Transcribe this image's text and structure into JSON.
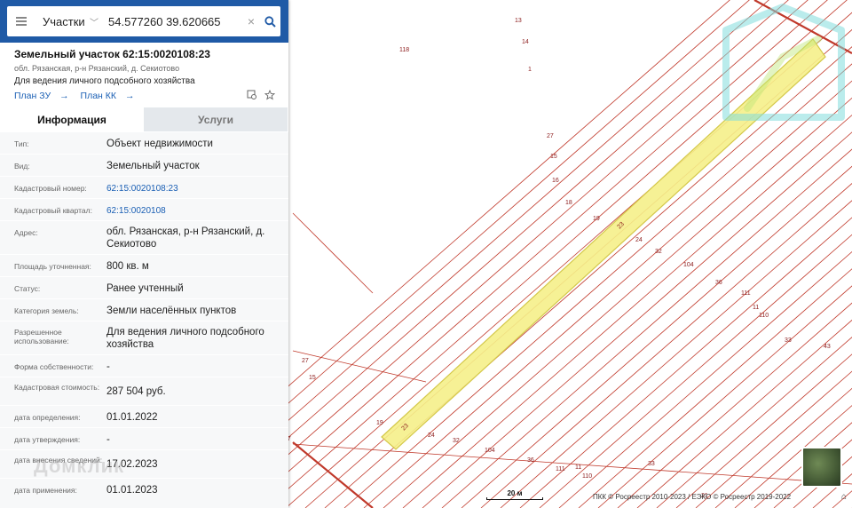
{
  "search": {
    "type": "Участки",
    "query": "54.577260 39.620665"
  },
  "parcel": {
    "title": "Земельный участок 62:15:0020108:23",
    "address_short": "обл. Рязанская, р-н Рязанский, д. Секиотово",
    "purpose": "Для ведения личного подсобного хозяйства",
    "links": [
      "План ЗУ",
      "План КК"
    ]
  },
  "tabs": [
    "Информация",
    "Услуги"
  ],
  "info": [
    {
      "label": "Тип:",
      "value": "Объект недвижимости"
    },
    {
      "label": "Вид:",
      "value": "Земельный участок"
    },
    {
      "label": "Кадастровый номер:",
      "value": "62:15:0020108:23"
    },
    {
      "label": "Кадастровый квартал:",
      "value": "62:15:0020108"
    },
    {
      "label": "Адрес:",
      "value": "обл. Рязанская, р-н Рязанский, д. Секиотово"
    },
    {
      "label": "Площадь уточненная:",
      "value": "800 кв. м"
    },
    {
      "label": "Статус:",
      "value": "Ранее учтенный"
    },
    {
      "label": "Категория земель:",
      "value": "Земли населённых пунктов"
    },
    {
      "label": "Разрешенное использование:",
      "value": "Для ведения личного подсобного хозяйства"
    },
    {
      "label": "Форма собственности:",
      "value": "-"
    },
    {
      "label": "Кадастровая стоимость:",
      "value": "287 504 руб."
    },
    {
      "label": "дата определения:",
      "value": "01.01.2022"
    },
    {
      "label": "дата утверждения:",
      "value": "-"
    },
    {
      "label": "дата внесения сведений:",
      "value": "17.02.2023"
    },
    {
      "label": "дата применения:",
      "value": "01.01.2023"
    }
  ],
  "watermark": "Домклик",
  "map": {
    "scale": "20 м",
    "copyright": "ПКК © Росреестр 2010-2023 / ЕЭКО © Росреестр 2019-2022",
    "labels": [
      "118",
      "13",
      "14",
      "1",
      "27",
      "15",
      "16",
      "18",
      "19",
      "23",
      "24",
      "32",
      "104",
      "36",
      "111",
      "11",
      "110",
      "33",
      "43",
      "27",
      "15",
      "19",
      "23",
      "24",
      "32",
      "104",
      "36",
      "111",
      "11",
      "110",
      "33",
      "27",
      "21"
    ],
    "colors": {
      "line": "#c0392b",
      "highlight_fill": "#f5f08a",
      "highlight_stroke": "#d4c84a",
      "panel_header": "#1f5aa6"
    }
  }
}
